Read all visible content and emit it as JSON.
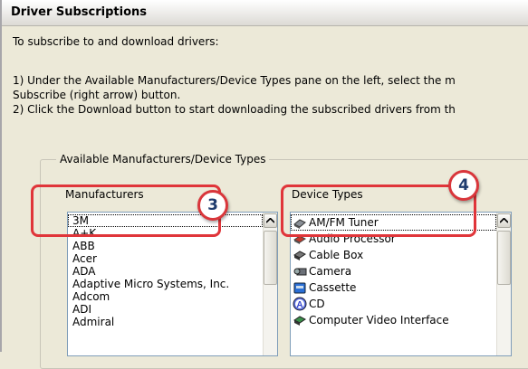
{
  "window": {
    "title": "Driver Subscriptions"
  },
  "instructions": {
    "intro": "To subscribe to and download drivers:",
    "step1_line1": "1) Under the Available Manufacturers/Device Types pane on the left, select the m",
    "step1_line2": "Subscribe (right arrow) button.",
    "step2": "2) Click the Download button to start downloading the subscribed drivers from th"
  },
  "group": {
    "title": "Available Manufacturers/Device Types"
  },
  "manufacturers": {
    "label": "Manufacturers",
    "items": [
      "3M",
      "A+K",
      "ABB",
      "Acer",
      "ADA",
      "Adaptive Micro Systems, Inc.",
      "Adcom",
      "ADI",
      "Admiral"
    ],
    "selected": "3M"
  },
  "device_types": {
    "label": "Device Types",
    "items": [
      {
        "label": "AM/FM Tuner",
        "icon": "tuner-icon"
      },
      {
        "label": "Audio Processor",
        "icon": "audio-processor-icon"
      },
      {
        "label": "Cable Box",
        "icon": "cable-box-icon"
      },
      {
        "label": "Camera",
        "icon": "camera-icon"
      },
      {
        "label": "Cassette",
        "icon": "cassette-icon"
      },
      {
        "label": "CD",
        "icon": "cd-icon"
      },
      {
        "label": "Computer Video Interface",
        "icon": "computer-video-interface-icon"
      }
    ],
    "selected": "AM/FM Tuner"
  },
  "callouts": [
    {
      "number": "3",
      "target": "manufacturers"
    },
    {
      "number": "4",
      "target": "device-types"
    }
  ],
  "colors": {
    "callout_red": "#e0353a",
    "callout_text": "#1f3c6e",
    "window_bg": "#ece9d8"
  }
}
